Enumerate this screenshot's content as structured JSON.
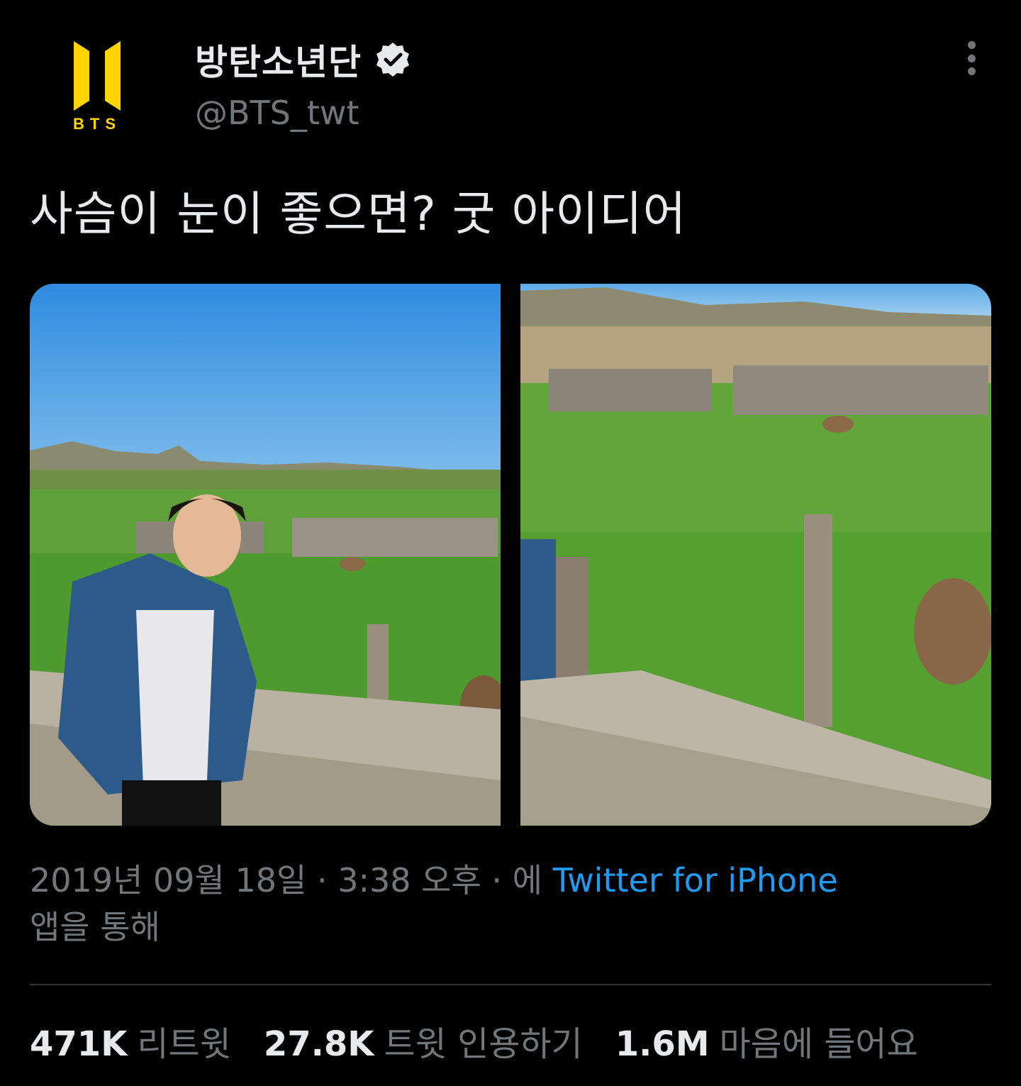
{
  "user": {
    "display_name": "방탄소년단",
    "handle": "@BTS_twt",
    "avatar_text": "BTS",
    "verified": true
  },
  "tweet": {
    "text": "사슴이 눈이 좋으면? 굿 아이디어"
  },
  "media": [
    {
      "alt_icon": "photo-person-with-deer"
    },
    {
      "alt_icon": "photo-deer-in-pen"
    }
  ],
  "meta": {
    "timestamp": "2019년 09월 18일 · 3:38 오후 · 에",
    "source": "Twitter for iPhone",
    "via": "앱을 통해"
  },
  "stats": {
    "retweets_count": "471K",
    "retweets_label": "리트윗",
    "quotes_count": "27.8K",
    "quotes_label": "트윗 인용하기",
    "likes_count": "1.6M",
    "likes_label": "마음에 들어요"
  },
  "colors": {
    "background": "#000000",
    "text": "#e7e9ea",
    "secondary": "#71767b",
    "link": "#1d9bf0",
    "brand_gold": "#ffd400"
  }
}
